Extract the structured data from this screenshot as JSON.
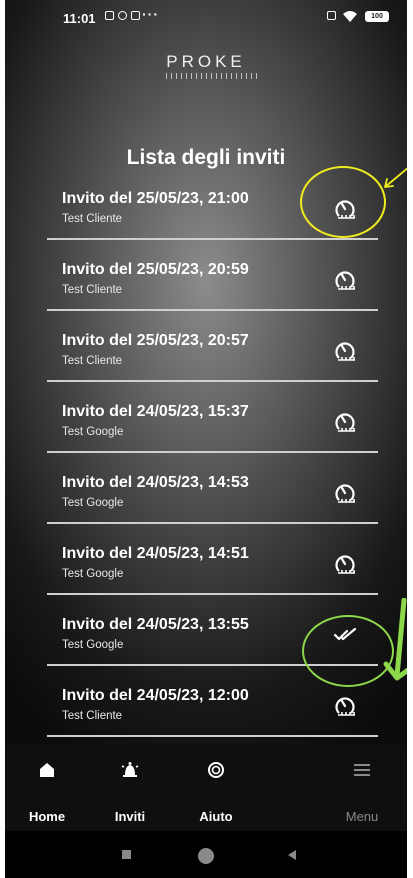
{
  "status_bar": {
    "time": "11:01",
    "overflow": "···",
    "battery": "100"
  },
  "brand": {
    "logo_text": "PROKE"
  },
  "page": {
    "title": "Lista degli inviti"
  },
  "invites": [
    {
      "title": "Invito del 25/05/23, 21:00",
      "subtitle": "Test Cliente",
      "status_icon": "pending-clock-icon"
    },
    {
      "title": "Invito del 25/05/23, 20:59",
      "subtitle": "Test Cliente",
      "status_icon": "pending-clock-icon"
    },
    {
      "title": "Invito del 25/05/23, 20:57",
      "subtitle": "Test Cliente",
      "status_icon": "pending-clock-icon"
    },
    {
      "title": "Invito del 24/05/23, 15:37",
      "subtitle": "Test Google",
      "status_icon": "pending-clock-icon"
    },
    {
      "title": "Invito del 24/05/23, 14:53",
      "subtitle": "Test Google",
      "status_icon": "pending-clock-icon"
    },
    {
      "title": "Invito del 24/05/23, 14:51",
      "subtitle": "Test Google",
      "status_icon": "pending-clock-icon"
    },
    {
      "title": "Invito del 24/05/23, 13:55",
      "subtitle": "Test Google",
      "status_icon": "double-check-icon"
    },
    {
      "title": "Invito del 24/05/23, 12:00",
      "subtitle": "Test Cliente",
      "status_icon": "pending-clock-icon"
    }
  ],
  "annotations": {
    "yellow": "#f0ec1e",
    "green": "#8cd84a"
  },
  "nav": {
    "home": "Home",
    "invites": "Inviti",
    "help": "Aiuto",
    "menu": "Menu"
  },
  "colors": {
    "active_label": "#ffffff",
    "inactive_label": "#8a8a8a"
  }
}
